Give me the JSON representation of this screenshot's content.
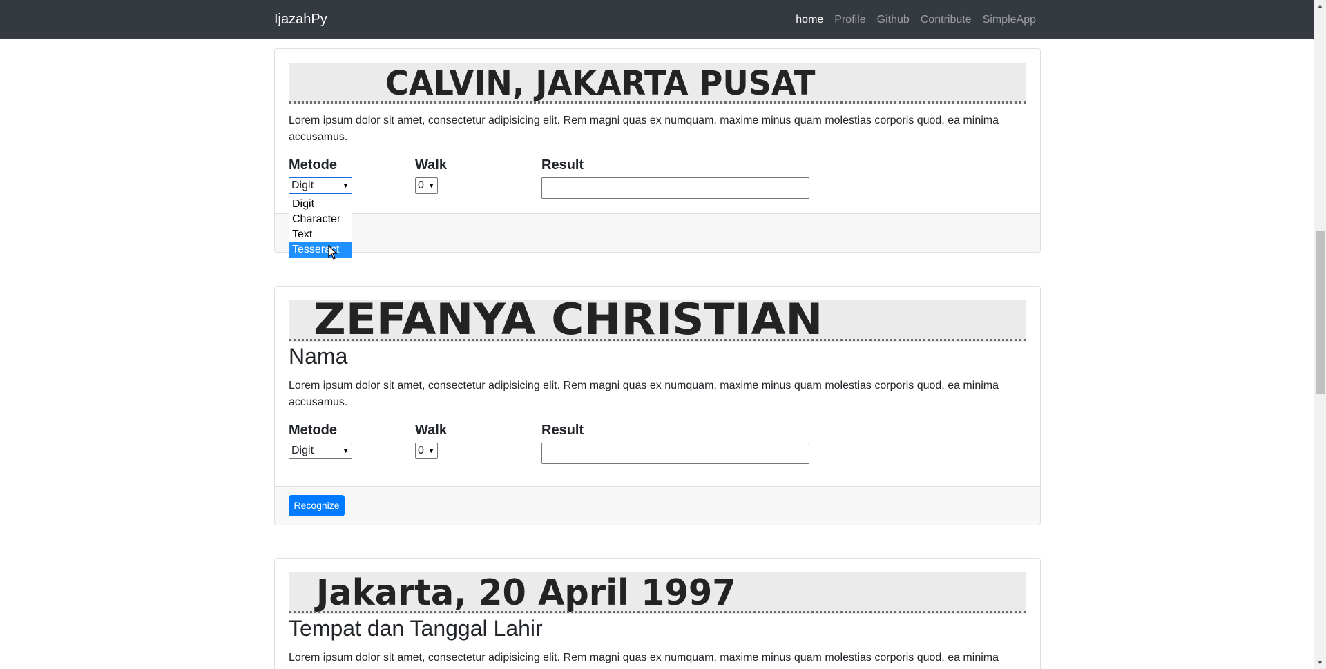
{
  "navbar": {
    "brand": "IjazahPy",
    "links": [
      "home",
      "Profile",
      "Github",
      "Contribute",
      "SimpleApp"
    ],
    "active": "home"
  },
  "cards": [
    {
      "scan_text": "CALVIN, JAKARTA PUSAT",
      "title": "",
      "description": "Lorem ipsum dolor sit amet, consectetur adipisicing elit. Rem magni quas ex numquam, maxime minus quam molestias corporis quod, ea minima accusamus.",
      "metode_label": "Metode",
      "metode_value": "Digit",
      "walk_label": "Walk",
      "walk_value": "0",
      "result_label": "Result",
      "result_value": "",
      "metode_options": [
        "Digit",
        "Character",
        "Text",
        "Tesseract"
      ],
      "highlighted_option": "Tesseract"
    },
    {
      "scan_text": "ZEFANYA CHRISTIAN",
      "title": "Nama",
      "description": "Lorem ipsum dolor sit amet, consectetur adipisicing elit. Rem magni quas ex numquam, maxime minus quam molestias corporis quod, ea minima accusamus.",
      "metode_label": "Metode",
      "metode_value": "Digit",
      "walk_label": "Walk",
      "walk_value": "0",
      "result_label": "Result",
      "result_value": "",
      "button_label": "Recognize"
    },
    {
      "scan_text": "Jakarta, 20 April 1997",
      "title": "Tempat dan Tanggal Lahir",
      "description": "Lorem ipsum dolor sit amet, consectetur adipisicing elit. Rem magni quas ex numquam, maxime minus quam molestias corporis quod, ea minima accusamus."
    }
  ],
  "colors": {
    "navbar_bg": "#343a40",
    "button_bg": "#007bff",
    "option_highlight": "#1e90ff"
  }
}
